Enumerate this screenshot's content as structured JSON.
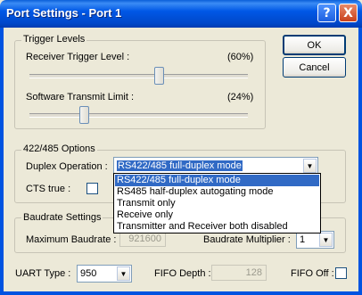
{
  "window": {
    "title": "Port Settings - Port 1",
    "help_glyph": "?",
    "close_glyph": "X"
  },
  "buttons": {
    "ok": "OK",
    "cancel": "Cancel"
  },
  "trigger": {
    "legend": "Trigger Levels",
    "receiver_label": "Receiver Trigger Level :",
    "receiver_value": "(60%)",
    "receiver_level": 0.6,
    "transmit_label": "Software Transmit Limit :",
    "transmit_value": "(24%)",
    "transmit_level": 0.24
  },
  "options422": {
    "legend": "422/485 Options",
    "duplex_label": "Duplex Operation :",
    "duplex_selected": "RS422/485 full-duplex mode",
    "cts_label": "CTS true :",
    "duplex_options": [
      "RS422/485 full-duplex mode",
      "RS485 half-duplex autogating mode",
      "Transmit only",
      "Receive only",
      "Transmitter and Receiver both disabled"
    ]
  },
  "baudrate": {
    "legend": "Baudrate Settings",
    "max_label": "Maximum Baudrate :",
    "max_value": "921600",
    "multiplier_label": "Baudrate Multiplier :",
    "multiplier_value": "1"
  },
  "bottom": {
    "uart_label": "UART Type :",
    "uart_value": "950",
    "fifo_depth_label": "FIFO Depth :",
    "fifo_depth_value": "128",
    "fifo_off_label": "FIFO Off :"
  },
  "icons": {
    "dropdown_arrow": "▼"
  }
}
